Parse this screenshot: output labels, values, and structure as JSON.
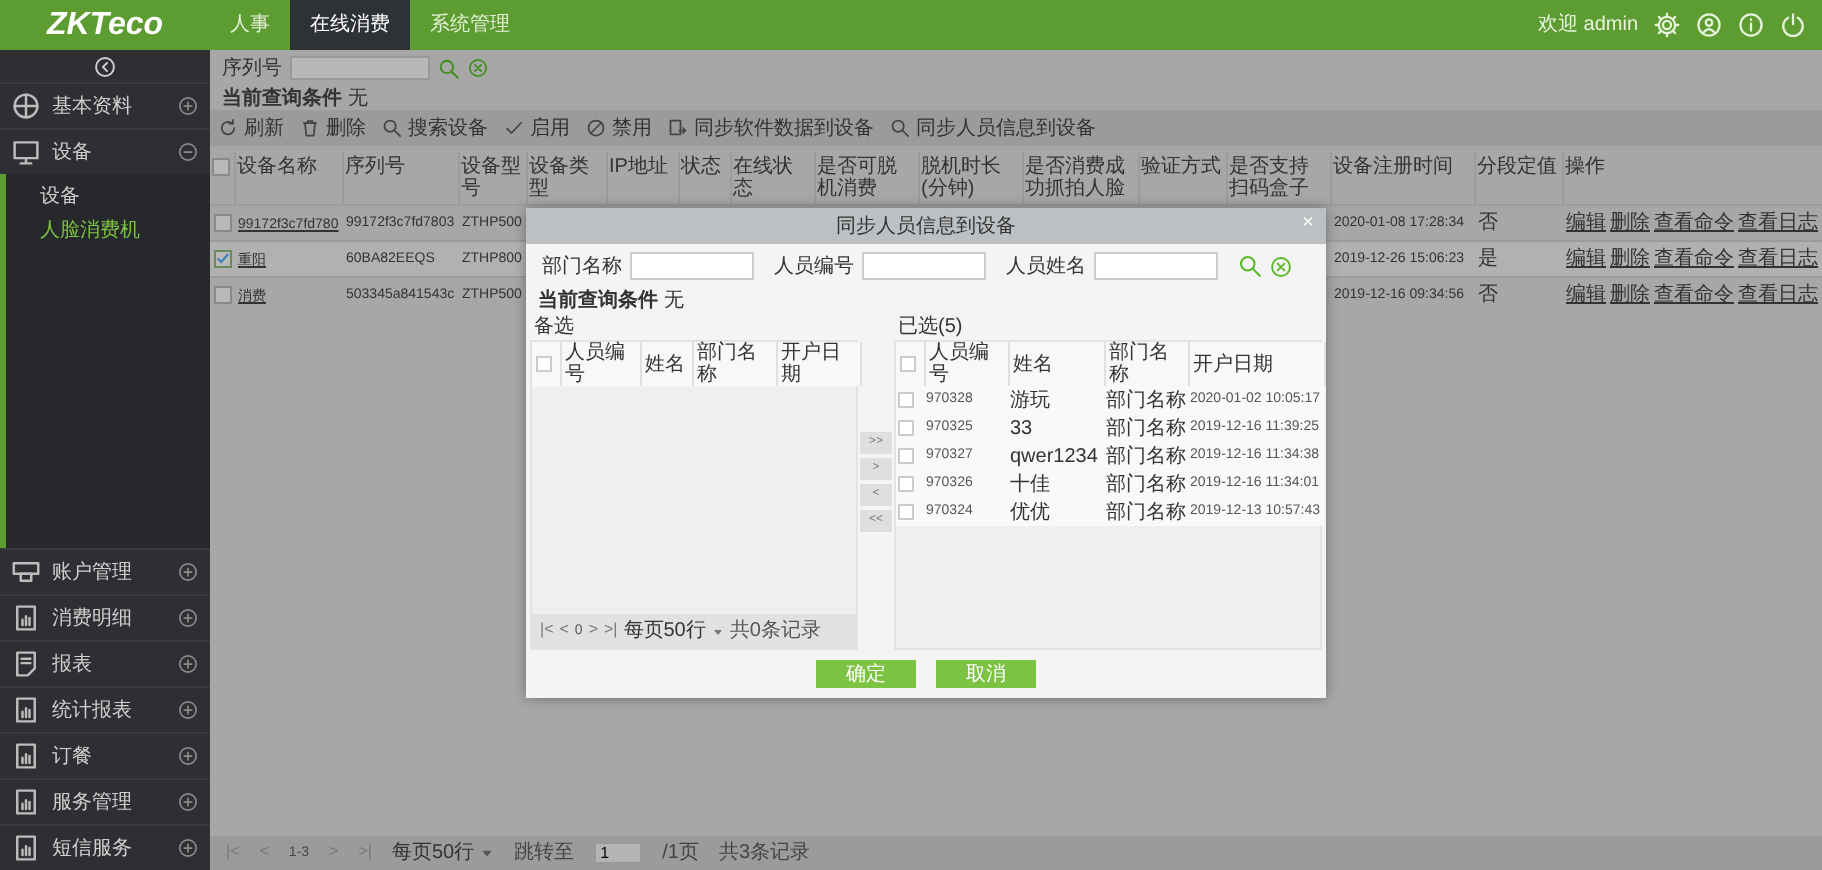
{
  "header": {
    "logo": "ZKTeco",
    "nav": [
      {
        "label": "人事",
        "selected": false
      },
      {
        "label": "在线消费",
        "selected": true
      },
      {
        "label": "系统管理",
        "selected": false
      }
    ],
    "welcome": "欢迎 admin"
  },
  "sidebar": {
    "items": [
      {
        "label": "基本资料",
        "expanded": false
      },
      {
        "label": "设备",
        "expanded": true,
        "children": [
          {
            "label": "设备",
            "selected": false
          },
          {
            "label": "人脸消费机",
            "selected": true
          }
        ]
      },
      {
        "label": "账户管理",
        "expanded": false
      },
      {
        "label": "消费明细",
        "expanded": false
      },
      {
        "label": "报表",
        "expanded": false
      },
      {
        "label": "统计报表",
        "expanded": false
      },
      {
        "label": "订餐",
        "expanded": false
      },
      {
        "label": "服务管理",
        "expanded": false
      },
      {
        "label": "短信服务",
        "expanded": false
      }
    ]
  },
  "filter": {
    "label": "序列号"
  },
  "query": {
    "label": "当前查询条件",
    "value": "无"
  },
  "toolbar": [
    {
      "label": "刷新"
    },
    {
      "label": "删除"
    },
    {
      "label": "搜索设备"
    },
    {
      "label": "启用"
    },
    {
      "label": "禁用"
    },
    {
      "label": "同步软件数据到设备"
    },
    {
      "label": "同步人员信息到设备"
    }
  ],
  "table": {
    "select_all": false,
    "columns": [
      "设备名称",
      "序列号",
      "设备型号",
      "设备类型",
      "IP地址",
      "状态",
      "在线状态",
      "是否可脱机消费",
      "脱机时长(分钟)",
      "是否消费成功抓拍人脸",
      "验证方式",
      "是否支持扫码盒子",
      "设备注册时间",
      "分段定值",
      "操作"
    ],
    "rows": [
      {
        "checked": false,
        "name": "99172f3c7fd780",
        "serial": "99172f3c7fd7803",
        "model": "ZTHP500",
        "registered": "2020-01-08 17:28:34",
        "segment": "否",
        "actions": [
          "编辑",
          "删除",
          "查看命令",
          "查看日志"
        ]
      },
      {
        "checked": true,
        "name": "重阳",
        "serial": "60BA82EEQS",
        "model": "ZTHP800",
        "registered": "2019-12-26 15:06:23",
        "segment": "是",
        "actions": [
          "编辑",
          "删除",
          "查看命令",
          "查看日志"
        ]
      },
      {
        "checked": false,
        "name": "消费",
        "serial": "503345a841543c",
        "model": "ZTHP500",
        "registered": "2019-12-16 09:34:56",
        "segment": "否",
        "actions": [
          "编辑",
          "删除",
          "查看命令",
          "查看日志"
        ]
      }
    ]
  },
  "pager": {
    "before": [
      "|<",
      "<"
    ],
    "range": "1-3",
    "after": [
      ">",
      ">|"
    ],
    "per_page": "每页50行",
    "jump_label": "跳转至",
    "page": "1",
    "pages": "/1页",
    "total": "共3条记录"
  },
  "dialog": {
    "title": "同步人员信息到设备",
    "close": "×",
    "fields": [
      {
        "label": "部门名称"
      },
      {
        "label": "人员编号"
      },
      {
        "label": "人员姓名"
      }
    ],
    "query": {
      "label": "当前查询条件",
      "value": "无"
    },
    "available": {
      "title": "备选",
      "select_all": false,
      "columns": [
        "人员编号",
        "姓名",
        "部门名称",
        "开户日期"
      ],
      "pager": {
        "before": [
          "|<",
          "<"
        ],
        "page": "0",
        "after": [
          ">",
          ">|"
        ],
        "per_page": "每页50行",
        "total": "共0条记录"
      }
    },
    "transfer": [
      ">>",
      ">",
      "<",
      "<<"
    ],
    "chosen": {
      "title": "已选(5)",
      "select_all": false,
      "columns": [
        "人员编号",
        "姓名",
        "部门名称",
        "开户日期"
      ],
      "rows": [
        {
          "checked": false,
          "cells": [
            "970328",
            "游玩",
            "部门名称",
            "2020-01-02 10:05:17"
          ]
        },
        {
          "checked": false,
          "cells": [
            "970325",
            "33",
            "部门名称",
            "2019-12-16 11:39:25"
          ]
        },
        {
          "checked": false,
          "cells": [
            "970327",
            "qwer1234",
            "部门名称",
            "2019-12-16 11:34:38"
          ]
        },
        {
          "checked": false,
          "cells": [
            "970326",
            "十佳",
            "部门名称",
            "2019-12-16 11:34:01"
          ]
        },
        {
          "checked": false,
          "cells": [
            "970324",
            "优优",
            "部门名称",
            "2019-12-13 10:57:43"
          ]
        }
      ]
    },
    "buttons": [
      "确定",
      "取消"
    ]
  }
}
